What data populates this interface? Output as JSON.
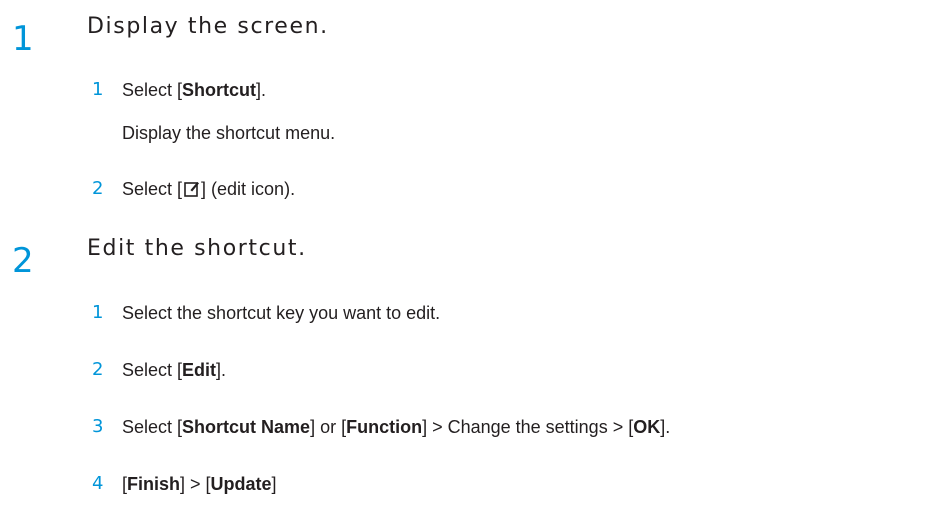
{
  "step1": {
    "number": "1",
    "title": "Display the screen.",
    "items": [
      {
        "num": "1",
        "prefix": "Select [",
        "bold": "Shortcut",
        "suffix": "]."
      },
      {
        "num": "2",
        "prefix": "Select [",
        "suffix": "] (edit icon)."
      }
    ],
    "note": "Display the shortcut menu.",
    "icon": "edit-icon"
  },
  "step2": {
    "number": "2",
    "title": "Edit the shortcut.",
    "items": [
      {
        "num": "1",
        "text": "Select the shortcut key you want to edit."
      },
      {
        "num": "2",
        "prefix": "Select [",
        "bold": "Edit",
        "suffix": "]."
      },
      {
        "num": "3",
        "prefix": "Select [",
        "bold1": "Shortcut Name",
        "mid1": "] or [",
        "bold2": "Function",
        "mid2": "] > Change the settings > [",
        "bold3": "OK",
        "suffix": "]."
      },
      {
        "num": "4",
        "prefix": "[",
        "bold1": "Finish",
        "mid1": "] > [",
        "bold2": "Update",
        "suffix": "]"
      }
    ]
  },
  "colors": {
    "accent": "#0095d9",
    "text": "#231f20"
  }
}
